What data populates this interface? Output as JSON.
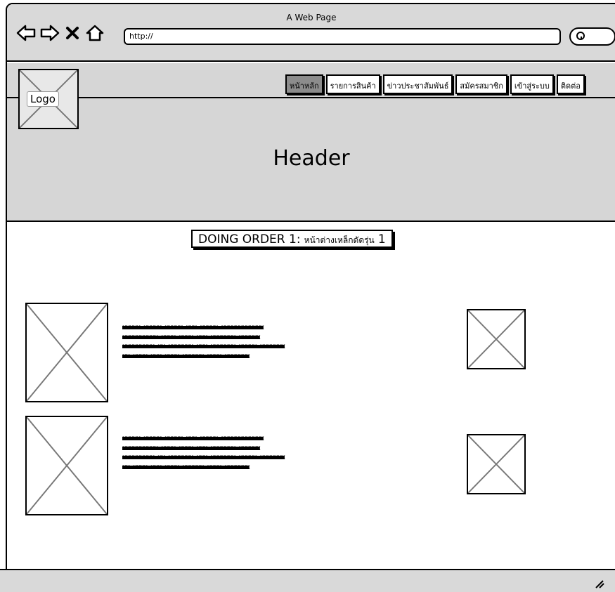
{
  "browser": {
    "window_title": "A Web Page",
    "url": "http://"
  },
  "header": {
    "logo_label": "Logo",
    "title": "Header",
    "nav": [
      {
        "label": "หน้าหลัก",
        "active": true
      },
      {
        "label": "รายการสินค้า",
        "active": false
      },
      {
        "label": "ข่าวประชาสัมพันธ์",
        "active": false
      },
      {
        "label": "สมัครสมาชิก",
        "active": false
      },
      {
        "label": "เข้าสู่ระบบ",
        "active": false
      },
      {
        "label": "ติดต่อ",
        "active": false
      }
    ]
  },
  "main": {
    "order_label": "DOING ORDER 1:",
    "order_name": "หน้าต่างเหล็กดัดรุ่น",
    "order_number": "1",
    "items": [
      {
        "lines": [
          "xxxxx xxxxx xxxxx xxx xxxxx xxxxxxxxxxxx",
          "xxxxxxxxxx xxxx xxxx xxx xxxxxxx xxxxxx",
          "xxxxxxxxx xx xxxxxxx xxx xxxxxxx xxxxx xxxxxxx",
          "xx xxxx xxx xxxx xxxxxx xxxx xxxxxxx"
        ]
      },
      {
        "lines": [
          "xxxxx xxxxx xxxxx xxx xxxxx xxxxxxxxxxxx",
          "xxxxxxxxxx xxxx xxxx xxx xxxxxxx xxxxxx",
          "xxxxxxxxx xx xxxxxxx xxx xxxxxxx xxxxx xxxxxxx",
          "xx xxxx xxx xxxx xxxxxx xxxx xxxxxxx"
        ]
      }
    ]
  }
}
